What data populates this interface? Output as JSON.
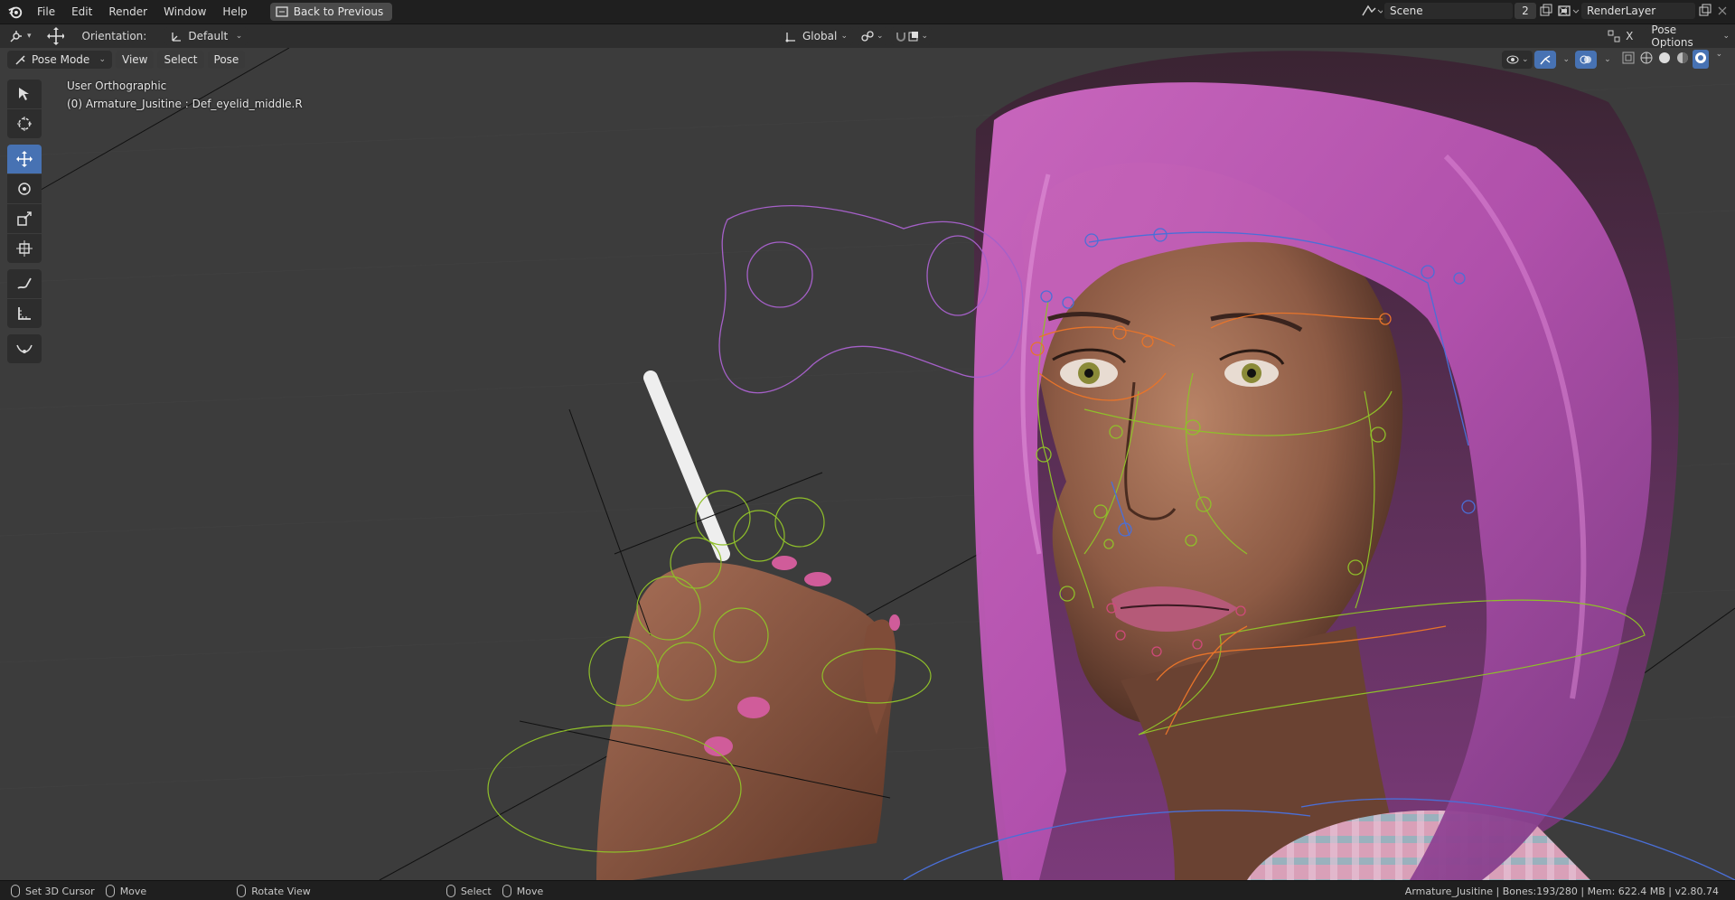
{
  "topbar": {
    "menus": [
      "File",
      "Edit",
      "Render",
      "Window",
      "Help"
    ],
    "back_label": "Back to Previous",
    "scene_label": "Scene",
    "scene_count": "2",
    "renderlayer_label": "RenderLayer"
  },
  "header": {
    "orientation_label": "Orientation:",
    "orientation_value": "Default",
    "transform_space": "Global",
    "pose_options": "Pose Options",
    "x_label": "X"
  },
  "subheader": {
    "mode": "Pose Mode",
    "menus": [
      "View",
      "Select",
      "Pose"
    ]
  },
  "viewport": {
    "view_name": "User Orthographic",
    "active_object": "(0) Armature_Jusitine : Def_eyelid_middle.R"
  },
  "statusbar": {
    "left": [
      "Set 3D Cursor",
      "Move",
      "Rotate View"
    ],
    "middle": [
      "Select",
      "Move"
    ],
    "stats": "Armature_Jusitine | Bones:193/280  |  Mem: 622.4 MB | v2.80.74"
  },
  "colors": {
    "accent": "#4772b3",
    "viewport_bg": "#3c3c3c",
    "hair": "#c25ab8",
    "bone_green": "#8fbf2a",
    "bone_orange": "#e8742a",
    "bone_blue": "#4a6fd8",
    "bone_purple": "#a560c8"
  }
}
